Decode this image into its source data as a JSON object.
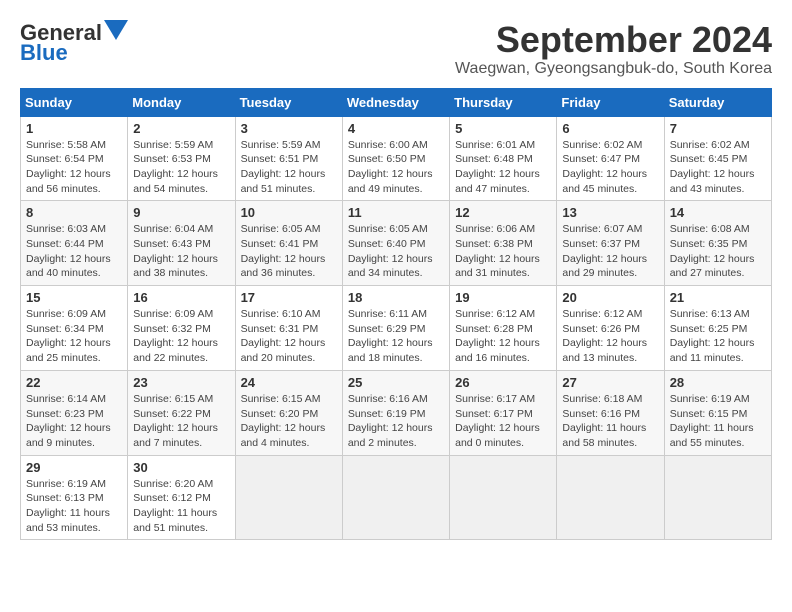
{
  "header": {
    "logo_line1": "General",
    "logo_line2": "Blue",
    "title": "September 2024",
    "subtitle": "Waegwan, Gyeongsangbuk-do, South Korea"
  },
  "calendar": {
    "days_of_week": [
      "Sunday",
      "Monday",
      "Tuesday",
      "Wednesday",
      "Thursday",
      "Friday",
      "Saturday"
    ],
    "weeks": [
      [
        {
          "day": "",
          "detail": "",
          "empty": true
        },
        {
          "day": "",
          "detail": "",
          "empty": true
        },
        {
          "day": "",
          "detail": "",
          "empty": true
        },
        {
          "day": "",
          "detail": "",
          "empty": true
        },
        {
          "day": "",
          "detail": "",
          "empty": true
        },
        {
          "day": "",
          "detail": "",
          "empty": true
        },
        {
          "day": "",
          "detail": "",
          "empty": true
        }
      ],
      [
        {
          "day": "1",
          "detail": "Sunrise: 5:58 AM\nSunset: 6:54 PM\nDaylight: 12 hours\nand 56 minutes.",
          "empty": false
        },
        {
          "day": "2",
          "detail": "Sunrise: 5:59 AM\nSunset: 6:53 PM\nDaylight: 12 hours\nand 54 minutes.",
          "empty": false
        },
        {
          "day": "3",
          "detail": "Sunrise: 5:59 AM\nSunset: 6:51 PM\nDaylight: 12 hours\nand 51 minutes.",
          "empty": false
        },
        {
          "day": "4",
          "detail": "Sunrise: 6:00 AM\nSunset: 6:50 PM\nDaylight: 12 hours\nand 49 minutes.",
          "empty": false
        },
        {
          "day": "5",
          "detail": "Sunrise: 6:01 AM\nSunset: 6:48 PM\nDaylight: 12 hours\nand 47 minutes.",
          "empty": false
        },
        {
          "day": "6",
          "detail": "Sunrise: 6:02 AM\nSunset: 6:47 PM\nDaylight: 12 hours\nand 45 minutes.",
          "empty": false
        },
        {
          "day": "7",
          "detail": "Sunrise: 6:02 AM\nSunset: 6:45 PM\nDaylight: 12 hours\nand 43 minutes.",
          "empty": false
        }
      ],
      [
        {
          "day": "8",
          "detail": "Sunrise: 6:03 AM\nSunset: 6:44 PM\nDaylight: 12 hours\nand 40 minutes.",
          "empty": false
        },
        {
          "day": "9",
          "detail": "Sunrise: 6:04 AM\nSunset: 6:43 PM\nDaylight: 12 hours\nand 38 minutes.",
          "empty": false
        },
        {
          "day": "10",
          "detail": "Sunrise: 6:05 AM\nSunset: 6:41 PM\nDaylight: 12 hours\nand 36 minutes.",
          "empty": false
        },
        {
          "day": "11",
          "detail": "Sunrise: 6:05 AM\nSunset: 6:40 PM\nDaylight: 12 hours\nand 34 minutes.",
          "empty": false
        },
        {
          "day": "12",
          "detail": "Sunrise: 6:06 AM\nSunset: 6:38 PM\nDaylight: 12 hours\nand 31 minutes.",
          "empty": false
        },
        {
          "day": "13",
          "detail": "Sunrise: 6:07 AM\nSunset: 6:37 PM\nDaylight: 12 hours\nand 29 minutes.",
          "empty": false
        },
        {
          "day": "14",
          "detail": "Sunrise: 6:08 AM\nSunset: 6:35 PM\nDaylight: 12 hours\nand 27 minutes.",
          "empty": false
        }
      ],
      [
        {
          "day": "15",
          "detail": "Sunrise: 6:09 AM\nSunset: 6:34 PM\nDaylight: 12 hours\nand 25 minutes.",
          "empty": false
        },
        {
          "day": "16",
          "detail": "Sunrise: 6:09 AM\nSunset: 6:32 PM\nDaylight: 12 hours\nand 22 minutes.",
          "empty": false
        },
        {
          "day": "17",
          "detail": "Sunrise: 6:10 AM\nSunset: 6:31 PM\nDaylight: 12 hours\nand 20 minutes.",
          "empty": false
        },
        {
          "day": "18",
          "detail": "Sunrise: 6:11 AM\nSunset: 6:29 PM\nDaylight: 12 hours\nand 18 minutes.",
          "empty": false
        },
        {
          "day": "19",
          "detail": "Sunrise: 6:12 AM\nSunset: 6:28 PM\nDaylight: 12 hours\nand 16 minutes.",
          "empty": false
        },
        {
          "day": "20",
          "detail": "Sunrise: 6:12 AM\nSunset: 6:26 PM\nDaylight: 12 hours\nand 13 minutes.",
          "empty": false
        },
        {
          "day": "21",
          "detail": "Sunrise: 6:13 AM\nSunset: 6:25 PM\nDaylight: 12 hours\nand 11 minutes.",
          "empty": false
        }
      ],
      [
        {
          "day": "22",
          "detail": "Sunrise: 6:14 AM\nSunset: 6:23 PM\nDaylight: 12 hours\nand 9 minutes.",
          "empty": false
        },
        {
          "day": "23",
          "detail": "Sunrise: 6:15 AM\nSunset: 6:22 PM\nDaylight: 12 hours\nand 7 minutes.",
          "empty": false
        },
        {
          "day": "24",
          "detail": "Sunrise: 6:15 AM\nSunset: 6:20 PM\nDaylight: 12 hours\nand 4 minutes.",
          "empty": false
        },
        {
          "day": "25",
          "detail": "Sunrise: 6:16 AM\nSunset: 6:19 PM\nDaylight: 12 hours\nand 2 minutes.",
          "empty": false
        },
        {
          "day": "26",
          "detail": "Sunrise: 6:17 AM\nSunset: 6:17 PM\nDaylight: 12 hours\nand 0 minutes.",
          "empty": false
        },
        {
          "day": "27",
          "detail": "Sunrise: 6:18 AM\nSunset: 6:16 PM\nDaylight: 11 hours\nand 58 minutes.",
          "empty": false
        },
        {
          "day": "28",
          "detail": "Sunrise: 6:19 AM\nSunset: 6:15 PM\nDaylight: 11 hours\nand 55 minutes.",
          "empty": false
        }
      ],
      [
        {
          "day": "29",
          "detail": "Sunrise: 6:19 AM\nSunset: 6:13 PM\nDaylight: 11 hours\nand 53 minutes.",
          "empty": false
        },
        {
          "day": "30",
          "detail": "Sunrise: 6:20 AM\nSunset: 6:12 PM\nDaylight: 11 hours\nand 51 minutes.",
          "empty": false
        },
        {
          "day": "",
          "detail": "",
          "empty": true
        },
        {
          "day": "",
          "detail": "",
          "empty": true
        },
        {
          "day": "",
          "detail": "",
          "empty": true
        },
        {
          "day": "",
          "detail": "",
          "empty": true
        },
        {
          "day": "",
          "detail": "",
          "empty": true
        }
      ]
    ]
  }
}
